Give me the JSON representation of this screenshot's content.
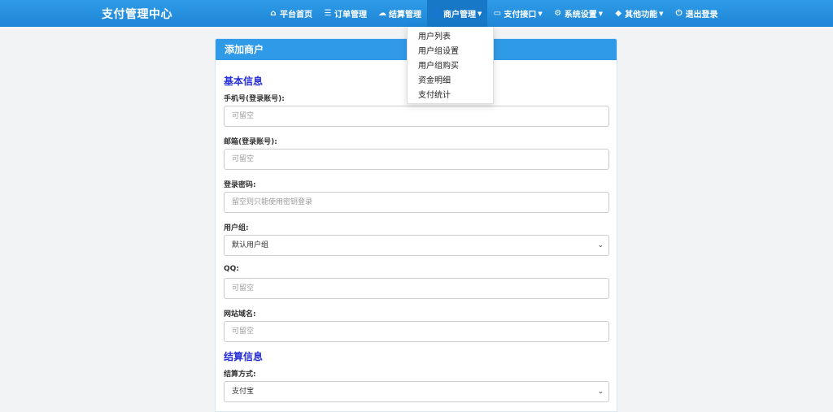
{
  "navbar": {
    "brand": "支付管理中心",
    "items": [
      {
        "label": "平台首页",
        "icon": "home-icon"
      },
      {
        "label": "订单管理",
        "icon": "list-icon"
      },
      {
        "label": "结算管理",
        "icon": "cloud-icon"
      },
      {
        "label": "商户管理",
        "icon": "user-icon",
        "dropdown": true,
        "active": true
      },
      {
        "label": "支付接口",
        "icon": "credit-card-icon",
        "dropdown": true
      },
      {
        "label": "系统设置",
        "icon": "gear-icon",
        "dropdown": true
      },
      {
        "label": "其他功能",
        "icon": "cube-icon",
        "dropdown": true
      },
      {
        "label": "退出登录",
        "icon": "power-icon"
      }
    ],
    "active_color": "#1778c7",
    "bar_color": "#2f9be8"
  },
  "dropdown": {
    "items": [
      "用户列表",
      "用户组设置",
      "用户组购买",
      "资金明细",
      "支付统计"
    ]
  },
  "panel": {
    "title": "添加商户",
    "basic_section": "基本信息",
    "settle_section": "结算信息",
    "fields": [
      {
        "label": "手机号(登录账号):",
        "placeholder": "可留空"
      },
      {
        "label": "邮箱(登录账号):",
        "placeholder": "可留空"
      },
      {
        "label": "登录密码:",
        "placeholder": "留空则只能使用密钥登录"
      },
      {
        "label": "用户组:",
        "value": "默认用户组"
      },
      {
        "label": "QQ:",
        "placeholder": "可留空"
      },
      {
        "label": "网站域名:",
        "placeholder": "可留空"
      }
    ],
    "settle_fields": [
      {
        "label": "结算方式:",
        "value": "支付宝"
      }
    ]
  }
}
